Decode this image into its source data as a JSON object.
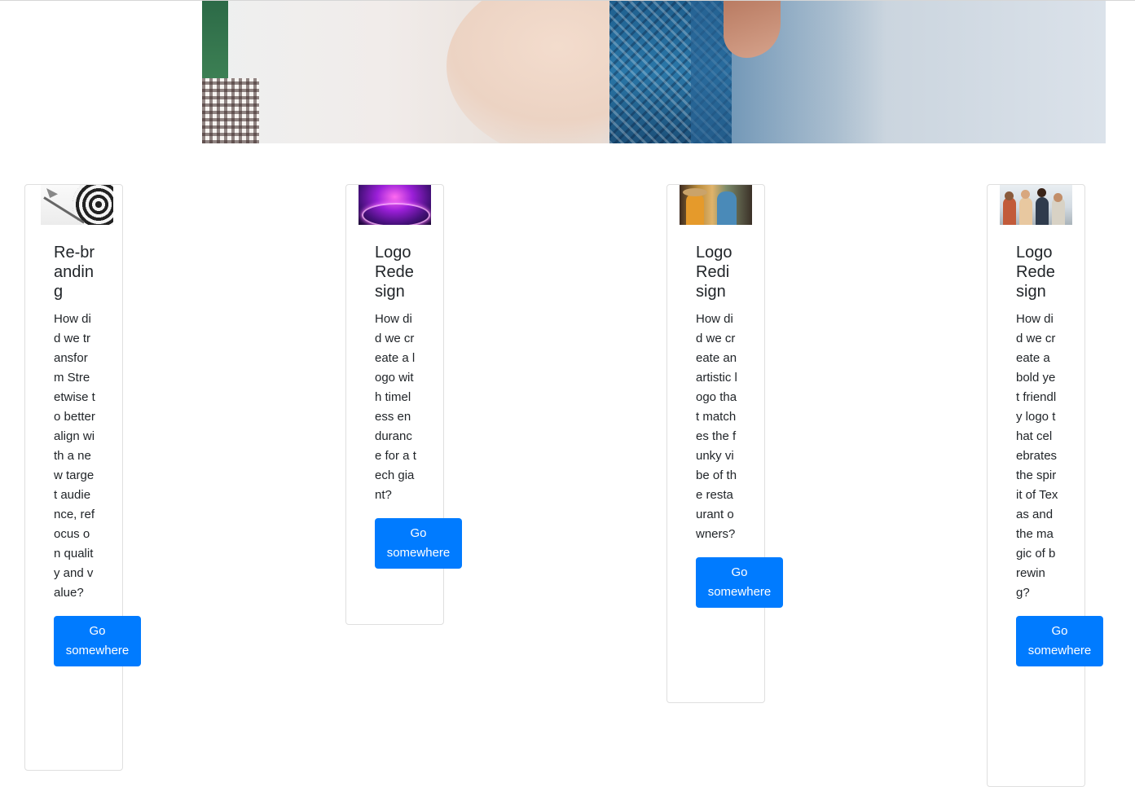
{
  "hero": {
    "image": "hero-banner-people-toasting"
  },
  "cards": [
    {
      "thumbnail": "dartboard-image",
      "title": "Re-branding",
      "text": "How did we transform Streetwise to better align with a new target audience, refocus on quality and value?",
      "button": "Go somewhere"
    },
    {
      "thumbnail": "neon-purple-image",
      "title": "Logo Redesign",
      "text": "How did we create a logo with timeless endurance for a tech giant?",
      "button": "Go somewhere"
    },
    {
      "thumbnail": "restaurant-friends-image",
      "title": "Logo Redisign",
      "text": "How did we create an artistic logo that matches the funky vibe of the restaurant owners?",
      "button": "Go somewhere"
    },
    {
      "thumbnail": "group-cheers-image",
      "title": "Logo Redesign",
      "text": "How did we create a bold yet friendly logo that celebrates the spirit of Texas and the magic of brewing?",
      "button": "Go somewhere"
    }
  ],
  "colors": {
    "button": "#007bff",
    "button_text": "#ffffff",
    "card_border": "#dfdfdf"
  }
}
